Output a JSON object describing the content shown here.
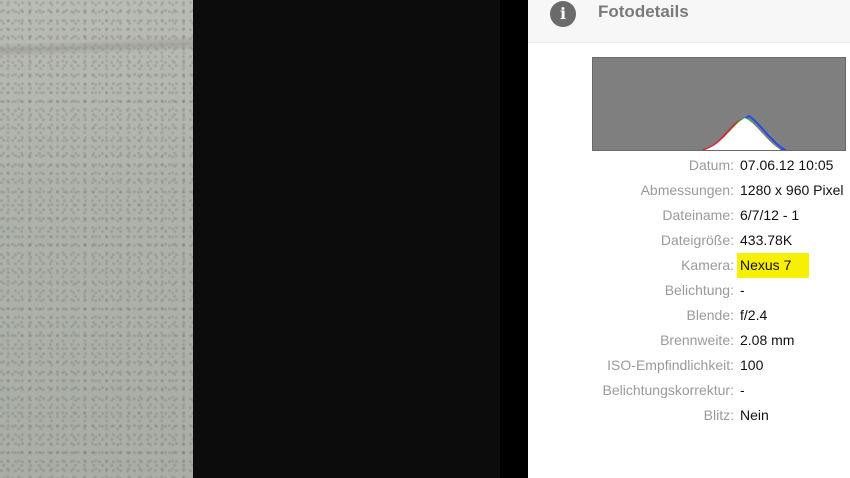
{
  "panel": {
    "icon": "info-icon",
    "title": "Fotodetails"
  },
  "histogram": {
    "icon": "histogram-graphic",
    "background": "#7f7f7f",
    "channels": [
      "red",
      "green",
      "blue"
    ]
  },
  "details": [
    {
      "label": "Datum:",
      "value": "07.06.12 10:05"
    },
    {
      "label": "Abmessungen:",
      "value": "1280 x 960 Pixel"
    },
    {
      "label": "Dateiname:",
      "value": "6/7/12 - 1"
    },
    {
      "label": "Dateigröße:",
      "value": "433.78K"
    },
    {
      "label": "Kamera:",
      "value": "Nexus 7",
      "highlight": true
    },
    {
      "label": "Belichtung:",
      "value": "-"
    },
    {
      "label": "Blende:",
      "value": "f/2.4"
    },
    {
      "label": "Brennweite:",
      "value": "2.08 mm"
    },
    {
      "label": "ISO-Empfindlichkeit:",
      "value": "100"
    },
    {
      "label": "Belichtungskorrektur:",
      "value": "-"
    },
    {
      "label": "Blitz:",
      "value": "Nein"
    }
  ],
  "colors": {
    "highlight": "#f7f000",
    "label": "#9a9a9a",
    "value": "#111111",
    "viewer_background": "#0c0c0c"
  }
}
